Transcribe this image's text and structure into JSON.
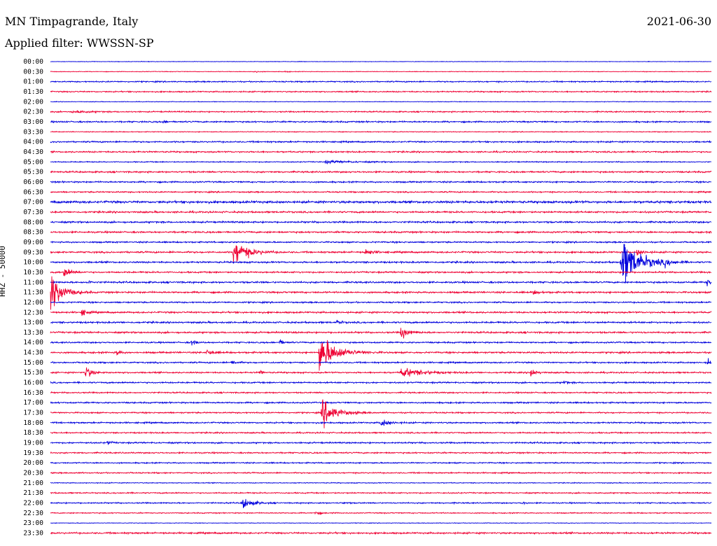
{
  "header": {
    "station": "MN Timpagrande, Italy",
    "filter": "Applied filter: WWSSN-SP",
    "date": "2021-06-30"
  },
  "colors": {
    "trace_a": "#0000dd",
    "trace_b": "#ee0033"
  },
  "chart_data": {
    "type": "line",
    "title": "MN Timpagrande, Italy",
    "subtitle": "Applied filter: WWSSN-SP",
    "ylabel": "HHZ - 50000",
    "row_labels": [
      "00:00",
      "00:30",
      "01:00",
      "01:30",
      "02:00",
      "02:30",
      "03:00",
      "03:30",
      "04:00",
      "04:30",
      "05:00",
      "05:30",
      "06:00",
      "06:30",
      "07:00",
      "07:30",
      "08:00",
      "08:30",
      "09:00",
      "09:30",
      "10:00",
      "10:30",
      "11:00",
      "11:30",
      "12:00",
      "12:30",
      "13:00",
      "13:30",
      "14:00",
      "14:30",
      "15:00",
      "15:30",
      "16:00",
      "16:30",
      "17:00",
      "17:30",
      "18:00",
      "18:30",
      "19:00",
      "19:30",
      "20:00",
      "20:30",
      "21:00",
      "21:30",
      "22:00",
      "22:30",
      "23:00",
      "23:30"
    ],
    "minutes_per_row": 30,
    "noise_level": [
      0.5,
      0.6,
      1.2,
      1.2,
      0.6,
      1.2,
      1.4,
      0.8,
      1.4,
      1.4,
      1.0,
      1.5,
      1.4,
      1.3,
      2.2,
      1.6,
      1.6,
      1.6,
      1.4,
      1.6,
      1.6,
      1.5,
      1.6,
      1.6,
      1.4,
      1.6,
      1.6,
      1.6,
      1.4,
      1.6,
      1.4,
      1.4,
      1.4,
      1.3,
      1.4,
      1.3,
      1.4,
      1.3,
      1.4,
      1.3,
      1.2,
      1.2,
      0.8,
      1.2,
      1.2,
      1.0,
      0.6,
      1.6
    ],
    "events": [
      {
        "row": "00:30",
        "minute": 9.2,
        "amplitude": 2.5,
        "duration_min": 0.5
      },
      {
        "row": "00:30",
        "minute": 10.6,
        "amplitude": 1.5,
        "duration_min": 0.5
      },
      {
        "row": "02:30",
        "minute": 1.0,
        "amplitude": 2.5,
        "duration_min": 1.8
      },
      {
        "row": "03:00",
        "minute": 5.1,
        "amplitude": 2.5,
        "duration_min": 0.5
      },
      {
        "row": "05:00",
        "minute": 12.5,
        "amplitude": 2.5,
        "duration_min": 3.5
      },
      {
        "row": "09:30",
        "minute": 8.3,
        "amplitude": 28,
        "duration_min": 1.5
      },
      {
        "row": "09:30",
        "minute": 14.3,
        "amplitude": 6,
        "duration_min": 0.8
      },
      {
        "row": "09:30",
        "minute": 26.6,
        "amplitude": 9,
        "duration_min": 0.6
      },
      {
        "row": "10:00",
        "minute": 25.9,
        "amplitude": 55,
        "duration_min": 2.0
      },
      {
        "row": "10:00",
        "minute": 27.9,
        "amplitude": 7,
        "duration_min": 0.5
      },
      {
        "row": "10:30",
        "minute": 0.6,
        "amplitude": 14,
        "duration_min": 0.7
      },
      {
        "row": "11:00",
        "minute": 1.7,
        "amplitude": 4,
        "duration_min": 0.3
      },
      {
        "row": "11:00",
        "minute": 29.8,
        "amplitude": 14,
        "duration_min": 0.3
      },
      {
        "row": "11:30",
        "minute": 0.0,
        "amplitude": 45,
        "duration_min": 1.2
      },
      {
        "row": "11:30",
        "minute": 21.9,
        "amplitude": 4,
        "duration_min": 0.7
      },
      {
        "row": "12:30",
        "minute": 1.4,
        "amplitude": 9,
        "duration_min": 0.5
      },
      {
        "row": "13:00",
        "minute": 13.0,
        "amplitude": 6,
        "duration_min": 0.4
      },
      {
        "row": "13:30",
        "minute": 15.9,
        "amplitude": 14,
        "duration_min": 0.8
      },
      {
        "row": "14:00",
        "minute": 6.4,
        "amplitude": 7,
        "duration_min": 0.4
      },
      {
        "row": "14:00",
        "minute": 10.4,
        "amplitude": 6,
        "duration_min": 0.4
      },
      {
        "row": "14:30",
        "minute": 3.0,
        "amplitude": 6,
        "duration_min": 0.4
      },
      {
        "row": "14:30",
        "minute": 7.1,
        "amplitude": 7,
        "duration_min": 0.6
      },
      {
        "row": "14:30",
        "minute": 12.2,
        "amplitude": 40,
        "duration_min": 1.8
      },
      {
        "row": "15:00",
        "minute": 8.2,
        "amplitude": 6,
        "duration_min": 0.5
      },
      {
        "row": "15:00",
        "minute": 29.8,
        "amplitude": 10,
        "duration_min": 0.4
      },
      {
        "row": "15:30",
        "minute": 1.6,
        "amplitude": 15,
        "duration_min": 0.6
      },
      {
        "row": "15:30",
        "minute": 9.5,
        "amplitude": 6,
        "duration_min": 0.3
      },
      {
        "row": "15:30",
        "minute": 15.9,
        "amplitude": 10,
        "duration_min": 2.4
      },
      {
        "row": "15:30",
        "minute": 21.8,
        "amplitude": 11,
        "duration_min": 0.5
      },
      {
        "row": "16:00",
        "minute": 23.3,
        "amplitude": 5,
        "duration_min": 0.4
      },
      {
        "row": "17:30",
        "minute": 12.3,
        "amplitude": 30,
        "duration_min": 1.5
      },
      {
        "row": "18:00",
        "minute": 15.0,
        "amplitude": 10,
        "duration_min": 0.8
      },
      {
        "row": "19:00",
        "minute": 2.6,
        "amplitude": 4,
        "duration_min": 0.4
      },
      {
        "row": "22:00",
        "minute": 8.7,
        "amplitude": 14,
        "duration_min": 1.0
      },
      {
        "row": "22:00",
        "minute": 13.3,
        "amplitude": 4,
        "duration_min": 0.3
      },
      {
        "row": "22:00",
        "minute": 21.4,
        "amplitude": 4,
        "duration_min": 0.3
      },
      {
        "row": "22:30",
        "minute": 12.0,
        "amplitude": 4,
        "duration_min": 0.5
      }
    ]
  }
}
